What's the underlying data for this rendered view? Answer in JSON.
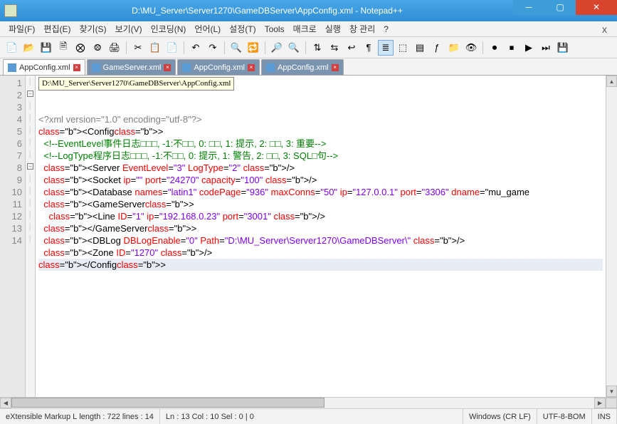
{
  "window": {
    "title": "D:\\MU_Server\\Server1270\\GameDBServer\\AppConfig.xml - Notepad++"
  },
  "menu": {
    "file": "파일(F)",
    "edit": "편집(E)",
    "search": "찾기(S)",
    "view": "보기(V)",
    "encoding": "인코딩(N)",
    "language": "언어(L)",
    "settings": "설정(T)",
    "tools": "Tools",
    "macro": "매크로",
    "run": "실행",
    "window": "창 관리",
    "help": "?"
  },
  "tabs": [
    {
      "label": "AppConfig.xml",
      "active": true
    },
    {
      "label": "GameServer.xml",
      "active": false
    },
    {
      "label": "AppConfig.xml",
      "active": false
    },
    {
      "label": "AppConfig.xml",
      "active": false
    }
  ],
  "tooltip": "D:\\MU_Server\\Server1270\\GameDBServer\\AppConfig.xml",
  "code": {
    "lines": [
      {
        "n": 1,
        "fold": "",
        "raw": "<?xml version=\"1.0\" encoding=\"utf-8\"?>"
      },
      {
        "n": 2,
        "fold": "-",
        "raw": "<Config>"
      },
      {
        "n": 3,
        "fold": "",
        "raw": "  <!--EventLevel事件日志□□□, -1:不□□, 0: □□, 1: 提示, 2: □□, 3: 重要-->"
      },
      {
        "n": 4,
        "fold": "",
        "raw": "  <!--LogType程序日志□□□, -1:不□□, 0: 提示, 1: 警告, 2: □□, 3: SQL□句-->"
      },
      {
        "n": 5,
        "fold": "",
        "raw": "  <Server EventLevel=\"3\" LogType=\"2\" />"
      },
      {
        "n": 6,
        "fold": "",
        "raw": "  <Socket ip=\"\" port=\"24270\" capacity=\"100\" />"
      },
      {
        "n": 7,
        "fold": "",
        "raw": "  <Database names=\"latin1\" codePage=\"936\" maxConns=\"50\" ip=\"127.0.0.1\" port=\"3306\" dname=\"mu_game"
      },
      {
        "n": 8,
        "fold": "-",
        "raw": "  <GameServer>"
      },
      {
        "n": 9,
        "fold": "",
        "raw": "    <Line ID=\"1\" ip=\"192.168.0.23\" port=\"3001\" />"
      },
      {
        "n": 10,
        "fold": "",
        "raw": "  </GameServer>"
      },
      {
        "n": 11,
        "fold": "",
        "raw": "  <DBLog DBLogEnable=\"0\" Path=\"D:\\MU_Server\\Server1270\\GameDBServer\\\" />"
      },
      {
        "n": 12,
        "fold": "",
        "raw": "  <Zone ID=\"1270\" />"
      },
      {
        "n": 13,
        "fold": "",
        "raw": "</Config>",
        "current": true
      },
      {
        "n": 14,
        "fold": "",
        "raw": ""
      }
    ]
  },
  "status": {
    "lang": "eXtensible Markup L",
    "length": "length : 722    lines : 14",
    "pos": "Ln : 13    Col : 10    Sel : 0 | 0",
    "eol": "Windows (CR LF)",
    "enc": "UTF-8-BOM",
    "mode": "INS"
  }
}
